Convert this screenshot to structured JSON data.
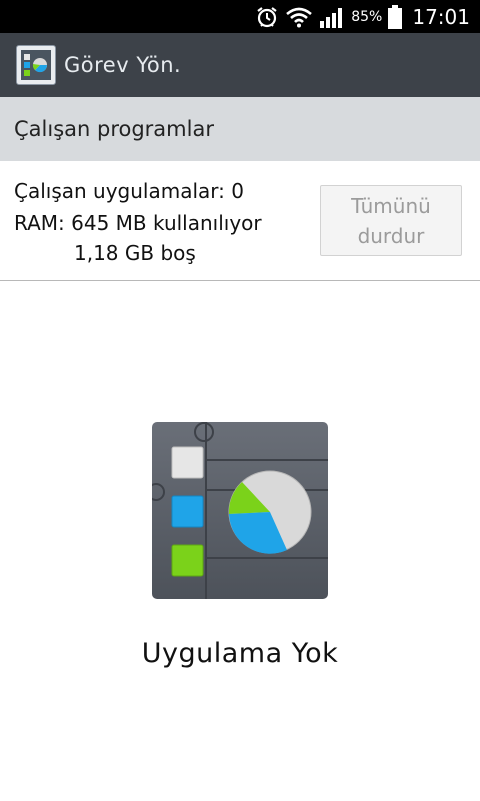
{
  "status_bar": {
    "battery_percent": "85%",
    "time": "17:01",
    "icons": [
      "alarm-icon",
      "wifi-icon",
      "signal-icon",
      "battery-icon"
    ]
  },
  "app_bar": {
    "title": "Görev Yön.",
    "icon": "task-manager-icon"
  },
  "section": {
    "title": "Çalışan programlar"
  },
  "info": {
    "running_apps": "Çalışan uygulamalar: 0",
    "ram_used": "RAM: 645 MB kullanılıyor",
    "ram_free": "1,18 GB boş"
  },
  "stop_all_button": {
    "line1": "Tümünü",
    "line2": "durdur"
  },
  "empty_state": {
    "icon": "task-manager-illustration-icon",
    "message": "Uygulama Yok"
  },
  "colors": {
    "app_bar": "#3d4249",
    "section_header": "#d7dadd",
    "tile_white": "#e6e6e6",
    "tile_blue": "#1fa4e8",
    "tile_green": "#7bd21a"
  }
}
